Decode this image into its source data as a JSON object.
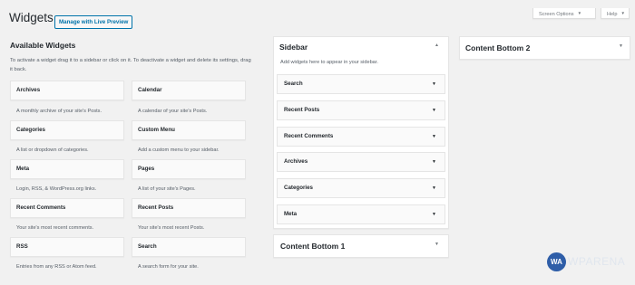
{
  "header": {
    "title": "Widgets",
    "live_preview_label": "Manage with Live Preview",
    "screen_options_label": "Screen Options",
    "help_label": "Help"
  },
  "available": {
    "title": "Available Widgets",
    "description": "To activate a widget drag it to a sidebar or click on it. To deactivate a widget and delete its settings, drag it back.",
    "widgets": [
      {
        "name": "Archives",
        "desc": "A monthly archive of your site's Posts."
      },
      {
        "name": "Calendar",
        "desc": "A calendar of your site's Posts."
      },
      {
        "name": "Categories",
        "desc": "A list or dropdown of categories."
      },
      {
        "name": "Custom Menu",
        "desc": "Add a custom menu to your sidebar."
      },
      {
        "name": "Meta",
        "desc": "Login, RSS, & WordPress.org links."
      },
      {
        "name": "Pages",
        "desc": "A list of your site's Pages."
      },
      {
        "name": "Recent Comments",
        "desc": "Your site's most recent comments."
      },
      {
        "name": "Recent Posts",
        "desc": "Your site's most recent Posts."
      },
      {
        "name": "RSS",
        "desc": "Entries from any RSS or Atom feed."
      },
      {
        "name": "Search",
        "desc": "A search form for your site."
      }
    ]
  },
  "sidebar": {
    "title": "Sidebar",
    "description": "Add widgets here to appear in your sidebar.",
    "widgets": [
      "Search",
      "Recent Posts",
      "Recent Comments",
      "Archives",
      "Categories",
      "Meta"
    ]
  },
  "areas": {
    "content_bottom_1": "Content Bottom 1",
    "content_bottom_2": "Content Bottom 2"
  },
  "watermark": {
    "logo": "WA",
    "text": "WPARENA"
  }
}
